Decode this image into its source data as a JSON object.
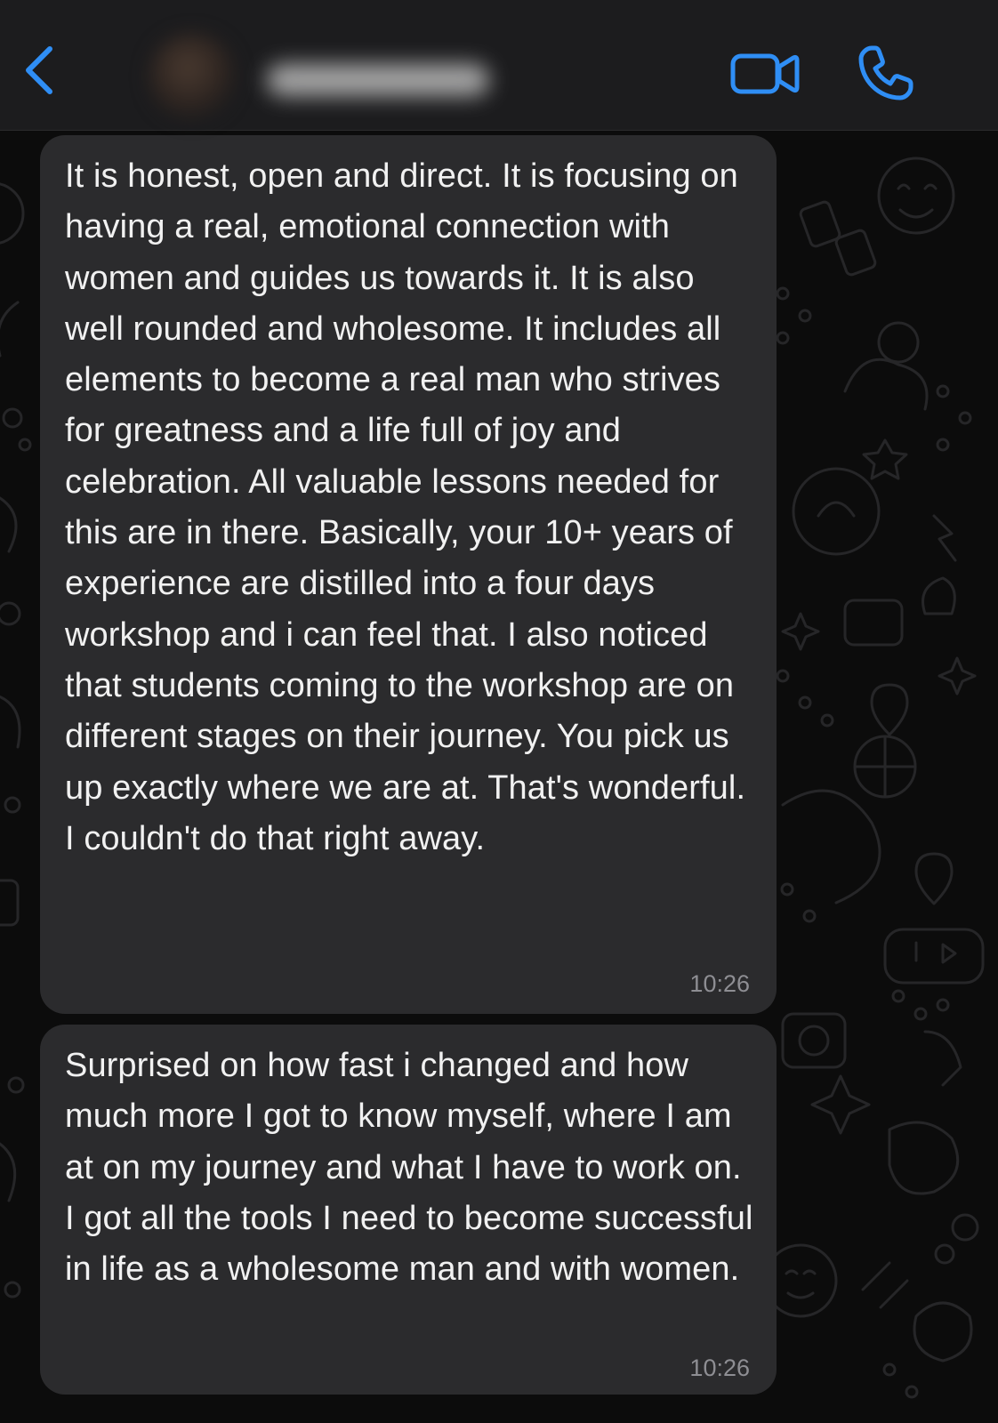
{
  "header": {
    "contact_name": "",
    "icons": {
      "back": "chevron-left-icon",
      "video": "video-camera-icon",
      "call": "phone-icon"
    },
    "accent_color": "#2f8ef5"
  },
  "messages": [
    {
      "text": "It is honest, open and direct. It is focusing on having a real, emotional connection with women and guides us towards it. It is also well rounded and wholesome. It includes all elements to become a real man who strives for greatness and a life full of joy and celebration. All valuable lessons needed for this are in there. Basically, your 10+ years of experience are distilled into a four days workshop and i can feel that. I also noticed that students coming to the workshop are on different stages on their journey. You pick us up exactly where we are at. That's wonderful. I couldn't do that right away.",
      "time": "10:26"
    },
    {
      "text": "Surprised on how fast i changed and how much more I got to know myself, where I am at on my journey and what I have to work on. I got all the tools I need to become successful in life as a wholesome man and with women.",
      "time": "10:26"
    }
  ],
  "colors": {
    "bubble_background": "#2b2b2d",
    "chat_background": "#0c0c0c",
    "header_background": "#1c1c1e",
    "text": "#f1f1f1",
    "timestamp": "#8e8e93"
  }
}
